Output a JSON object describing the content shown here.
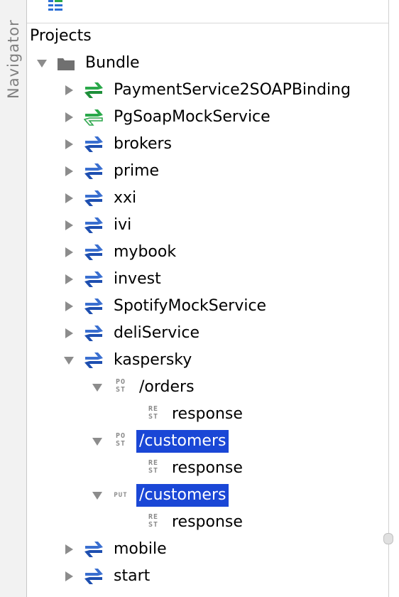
{
  "sidebar": {
    "label": "Navigator"
  },
  "tree": {
    "root_title": "Projects",
    "bundle": "Bundle",
    "soap_items": [
      "PaymentService2SOAPBinding",
      "PgSoapMockService"
    ],
    "rest_items": [
      "brokers",
      "prime",
      "xxi",
      "ivi",
      "mybook",
      "invest",
      "SpotifyMockService",
      "deliService",
      "kaspersky"
    ],
    "kaspersky_children": [
      {
        "method_badge": "PO\nST",
        "path": "/orders",
        "child": "response",
        "child_badge": "RE\nST"
      },
      {
        "method_badge": "PO\nST",
        "path": "/customers",
        "child": "response",
        "child_badge": "RE\nST"
      },
      {
        "method_badge": "PUT",
        "path": "/customers",
        "child": "response",
        "child_badge": "RE\nST"
      }
    ],
    "tail_items": [
      "mobile",
      "start"
    ]
  },
  "colors": {
    "selection": "#1a47d6",
    "soap_green": "#2aa84a",
    "rest_blue": "#1e4fb0"
  }
}
